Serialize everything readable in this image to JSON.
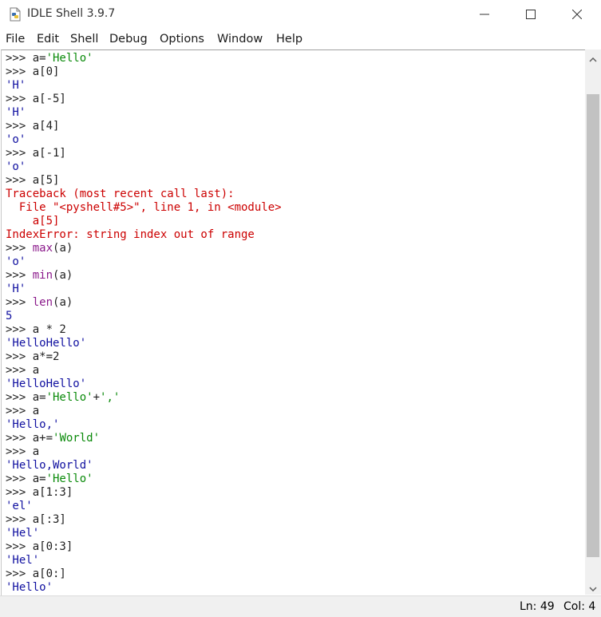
{
  "window": {
    "title": "IDLE Shell 3.9.7"
  },
  "menu": [
    "File",
    "Edit",
    "Shell",
    "Debug",
    "Options",
    "Window",
    "Help"
  ],
  "lines": [
    [
      {
        "t": ">>> ",
        "c": "p"
      },
      {
        "t": "a=",
        "c": "p"
      },
      {
        "t": "'Hello'",
        "c": "s"
      }
    ],
    [
      {
        "t": ">>> ",
        "c": "p"
      },
      {
        "t": "a[0]",
        "c": "p"
      }
    ],
    [
      {
        "t": "'H'",
        "c": "o"
      }
    ],
    [
      {
        "t": ">>> ",
        "c": "p"
      },
      {
        "t": "a[-5]",
        "c": "p"
      }
    ],
    [
      {
        "t": "'H'",
        "c": "o"
      }
    ],
    [
      {
        "t": ">>> ",
        "c": "p"
      },
      {
        "t": "a[4]",
        "c": "p"
      }
    ],
    [
      {
        "t": "'o'",
        "c": "o"
      }
    ],
    [
      {
        "t": ">>> ",
        "c": "p"
      },
      {
        "t": "a[-1]",
        "c": "p"
      }
    ],
    [
      {
        "t": "'o'",
        "c": "o"
      }
    ],
    [
      {
        "t": ">>> ",
        "c": "p"
      },
      {
        "t": "a[5]",
        "c": "p"
      }
    ],
    [
      {
        "t": "Traceback (most recent call last):",
        "c": "e"
      }
    ],
    [
      {
        "t": "  File \"<pyshell#5>\", line 1, in <module>",
        "c": "e"
      }
    ],
    [
      {
        "t": "    a[5]",
        "c": "e"
      }
    ],
    [
      {
        "t": "IndexError: string index out of range",
        "c": "e"
      }
    ],
    [
      {
        "t": ">>> ",
        "c": "p"
      },
      {
        "t": "max",
        "c": "b"
      },
      {
        "t": "(a)",
        "c": "p"
      }
    ],
    [
      {
        "t": "'o'",
        "c": "o"
      }
    ],
    [
      {
        "t": ">>> ",
        "c": "p"
      },
      {
        "t": "min",
        "c": "b"
      },
      {
        "t": "(a)",
        "c": "p"
      }
    ],
    [
      {
        "t": "'H'",
        "c": "o"
      }
    ],
    [
      {
        "t": ">>> ",
        "c": "p"
      },
      {
        "t": "len",
        "c": "b"
      },
      {
        "t": "(a)",
        "c": "p"
      }
    ],
    [
      {
        "t": "5",
        "c": "o"
      }
    ],
    [
      {
        "t": ">>> ",
        "c": "p"
      },
      {
        "t": "a * 2",
        "c": "p"
      }
    ],
    [
      {
        "t": "'HelloHello'",
        "c": "o"
      }
    ],
    [
      {
        "t": ">>> ",
        "c": "p"
      },
      {
        "t": "a*=2",
        "c": "p"
      }
    ],
    [
      {
        "t": ">>> ",
        "c": "p"
      },
      {
        "t": "a",
        "c": "p"
      }
    ],
    [
      {
        "t": "'HelloHello'",
        "c": "o"
      }
    ],
    [
      {
        "t": ">>> ",
        "c": "p"
      },
      {
        "t": "a=",
        "c": "p"
      },
      {
        "t": "'Hello'",
        "c": "s"
      },
      {
        "t": "+",
        "c": "p"
      },
      {
        "t": "','",
        "c": "s"
      }
    ],
    [
      {
        "t": ">>> ",
        "c": "p"
      },
      {
        "t": "a",
        "c": "p"
      }
    ],
    [
      {
        "t": "'Hello,'",
        "c": "o"
      }
    ],
    [
      {
        "t": ">>> ",
        "c": "p"
      },
      {
        "t": "a+=",
        "c": "p"
      },
      {
        "t": "'World'",
        "c": "s"
      }
    ],
    [
      {
        "t": ">>> ",
        "c": "p"
      },
      {
        "t": "a",
        "c": "p"
      }
    ],
    [
      {
        "t": "'Hello,World'",
        "c": "o"
      }
    ],
    [
      {
        "t": ">>> ",
        "c": "p"
      },
      {
        "t": "a=",
        "c": "p"
      },
      {
        "t": "'Hello'",
        "c": "s"
      }
    ],
    [
      {
        "t": ">>> ",
        "c": "p"
      },
      {
        "t": "a[1:3]",
        "c": "p"
      }
    ],
    [
      {
        "t": "'el'",
        "c": "o"
      }
    ],
    [
      {
        "t": ">>> ",
        "c": "p"
      },
      {
        "t": "a[:3]",
        "c": "p"
      }
    ],
    [
      {
        "t": "'Hel'",
        "c": "o"
      }
    ],
    [
      {
        "t": ">>> ",
        "c": "p"
      },
      {
        "t": "a[0:3]",
        "c": "p"
      }
    ],
    [
      {
        "t": "'Hel'",
        "c": "o"
      }
    ],
    [
      {
        "t": ">>> ",
        "c": "p"
      },
      {
        "t": "a[0:]",
        "c": "p"
      }
    ],
    [
      {
        "t": "'Hello'",
        "c": "o"
      }
    ]
  ],
  "status": {
    "line": "Ln: 49",
    "col": "Col: 4"
  },
  "colors": {
    "prompt": "#1f1f1f",
    "string": "#0a8a0a",
    "output": "#1010a0",
    "builtin": "#8b1a8b",
    "error": "#cc0000"
  },
  "icons": {
    "app": "python-file-icon",
    "minimize": "minimize-icon",
    "maximize": "maximize-icon",
    "close": "close-icon",
    "scroll_up": "chevron-up-icon",
    "scroll_down": "chevron-down-icon"
  }
}
